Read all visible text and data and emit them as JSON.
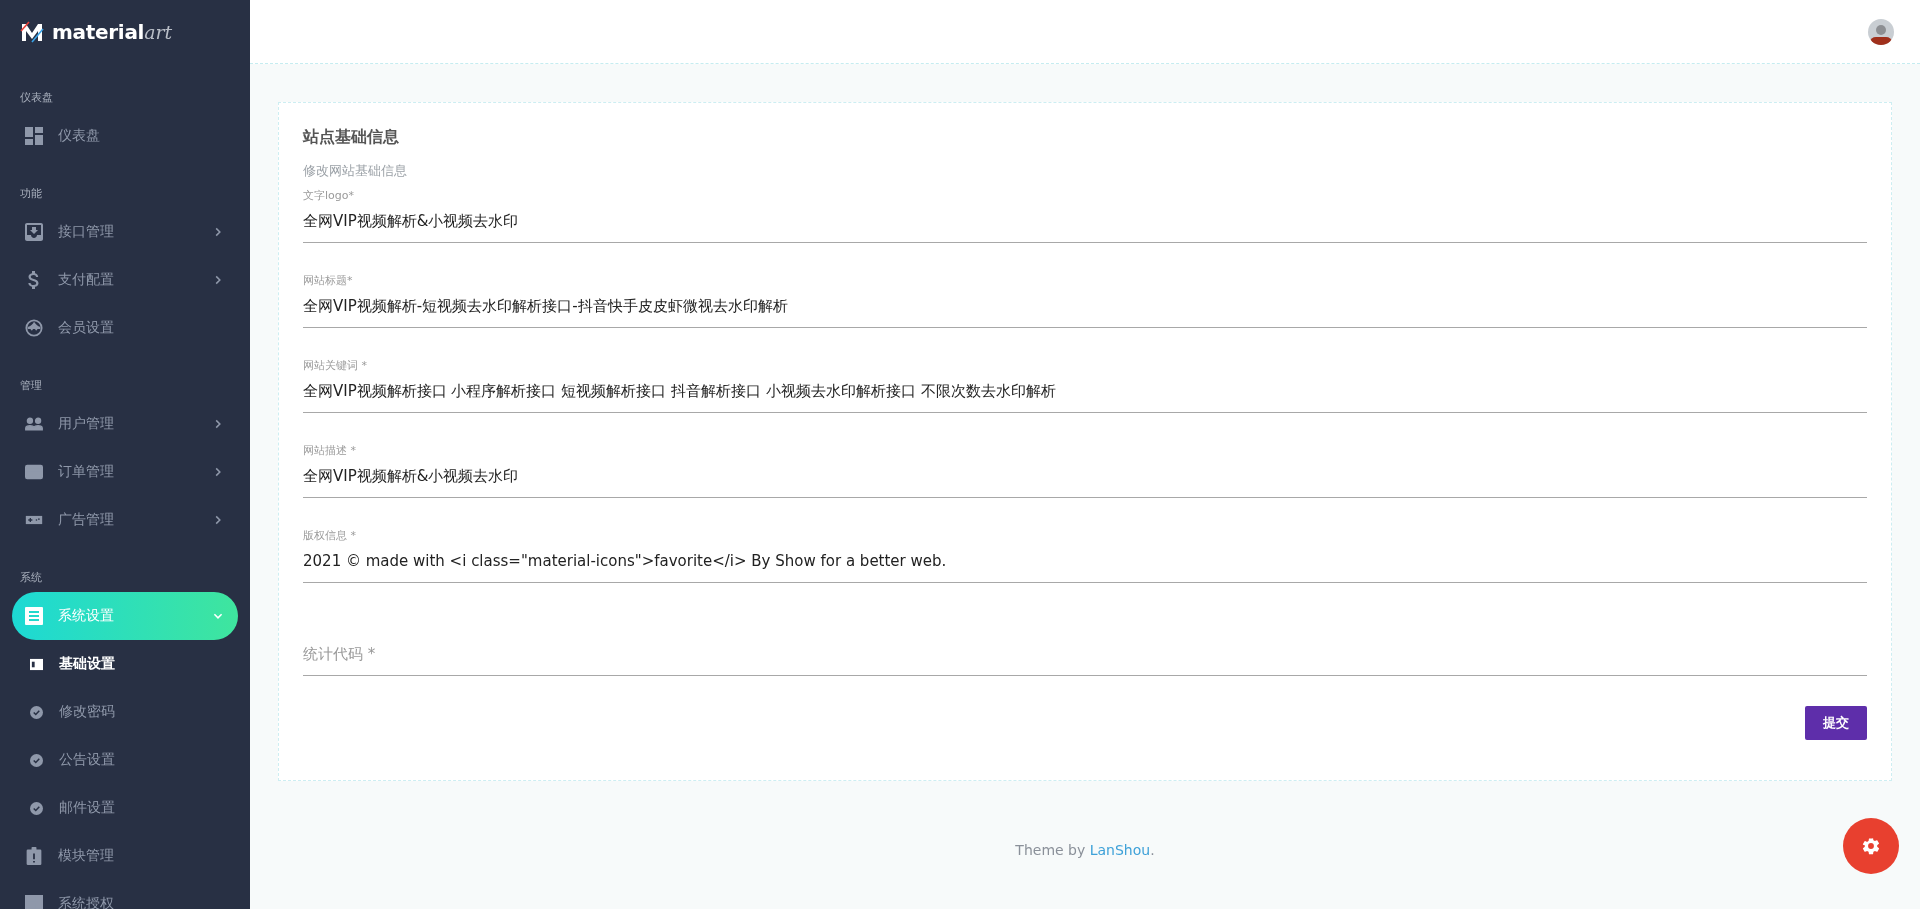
{
  "sidebar": {
    "logo": {
      "text": "material",
      "accent": "art"
    },
    "sections": [
      {
        "title": "仪表盘",
        "items": [
          {
            "label": "仪表盘",
            "expandable": false,
            "selected": false
          }
        ]
      },
      {
        "title": "功能",
        "items": [
          {
            "label": "接口管理",
            "expandable": true,
            "selected": false
          },
          {
            "label": "支付配置",
            "expandable": true,
            "selected": false
          },
          {
            "label": "会员设置",
            "expandable": false,
            "selected": false
          }
        ]
      },
      {
        "title": "管理",
        "items": [
          {
            "label": "用户管理",
            "expandable": true,
            "selected": false
          },
          {
            "label": "订单管理",
            "expandable": true,
            "selected": false
          },
          {
            "label": "广告管理",
            "expandable": true,
            "selected": false
          }
        ]
      },
      {
        "title": "系统",
        "items": [
          {
            "label": "系统设置",
            "expandable": true,
            "expanded": true,
            "selected": true,
            "children": [
              {
                "label": "基础设置",
                "selected": true
              },
              {
                "label": "修改密码",
                "selected": false
              },
              {
                "label": "公告设置",
                "selected": false
              },
              {
                "label": "邮件设置",
                "selected": false
              }
            ]
          },
          {
            "label": "模块管理",
            "expandable": false,
            "selected": false
          },
          {
            "label": "系统授权",
            "expandable": false,
            "selected": false
          }
        ]
      }
    ]
  },
  "form": {
    "title": "站点基础信息",
    "subtitle": "修改网站基础信息",
    "fields": [
      {
        "label": "文字logo*",
        "value": "全网VIP视频解析&小视频去水印"
      },
      {
        "label": "网站标题*",
        "value": "全网VIP视频解析-短视频去水印解析接口-抖音快手皮皮虾微视去水印解析"
      },
      {
        "label": "网站关键词 *",
        "value": "全网VIP视频解析接口 小程序解析接口 短视频解析接口 抖音解析接口 小视频去水印解析接口 不限次数去水印解析"
      },
      {
        "label": "网站描述 *",
        "value": "全网VIP视频解析&小视频去水印"
      },
      {
        "label": "版权信息 *",
        "value": "2021 © made with <i class=\"material-icons\">favorite</i> By Show for a better web."
      },
      {
        "placeholder": "统计代码 *"
      }
    ],
    "submit": "提交"
  },
  "footer": {
    "prefix": "Theme by ",
    "link": "LanShou",
    "suffix": "."
  }
}
